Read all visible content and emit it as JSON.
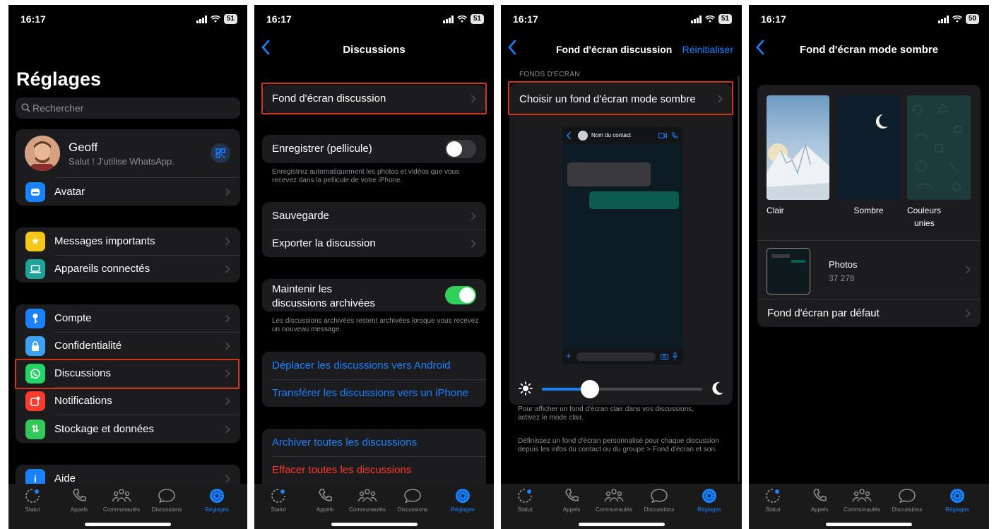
{
  "colors": {
    "accent": "#1a82ff",
    "destructive": "#ff3b30",
    "toggle_on": "#30d158",
    "highlight": "#d0351f"
  },
  "tabbar": {
    "items": [
      {
        "label": "Statut",
        "icon": "status-icon"
      },
      {
        "label": "Appels",
        "icon": "phone-icon"
      },
      {
        "label": "Communautés",
        "icon": "communities-icon"
      },
      {
        "label": "Discussions",
        "icon": "chat-bubble-icon"
      },
      {
        "label": "Réglages",
        "icon": "settings-gear-icon",
        "active": true
      }
    ]
  },
  "screen1": {
    "time": "16:17",
    "battery": "51",
    "title": "Réglages",
    "search_placeholder": "Rechercher",
    "profile": {
      "name": "Geoff",
      "status": "Salut ! J'utilise WhatsApp."
    },
    "avatar_row": "Avatar",
    "group2": [
      "Messages importants",
      "Appareils connectés"
    ],
    "group3": [
      "Compte",
      "Confidentialité",
      "Discussions",
      "Notifications",
      "Stockage et données"
    ],
    "help": "Aide"
  },
  "screen2": {
    "time": "16:17",
    "battery": "51",
    "title": "Discussions",
    "wallpaper": "Fond d'écran discussion",
    "save_camera": "Enregistrer (pellicule)",
    "save_camera_note": "Enregistrez automatiquement les photos et vidéos que vous recevez dans la pellicule de votre iPhone.",
    "backup": "Sauvegarde",
    "export": "Exporter la discussion",
    "keep_archived_line1": "Maintenir les",
    "keep_archived_line2": "discussions archivées",
    "keep_archived_note": "Les discussions archivées restent archivées lorsque vous recevez un nouveau message.",
    "move_android": "Déplacer les discussions vers Android",
    "transfer_iphone": "Transférer les discussions vers un iPhone",
    "archive_all": "Archiver toutes les discussions",
    "clear_all": "Effacer toutes les discussions"
  },
  "screen3": {
    "time": "16:17",
    "battery": "51",
    "title": "Fond d'écran discussion",
    "reset": "Réinitialiser",
    "section": "FONDS D'ÉCRAN",
    "choose_dark": "Choisir un fond d'écran mode sombre",
    "preview_contact": "Nom du contact",
    "brightness": 0.3,
    "note1": "Pour afficher un fond d'écran clair dans vos discussions, activez le mode clair.",
    "note2": "Définissez un fond d'écran personnalisé pour chaque discussion depuis les infos du contact ou du groupe > Fond d'écran et son."
  },
  "screen4": {
    "time": "16:17",
    "battery": "50",
    "title": "Fond d'écran mode sombre",
    "tiles": [
      {
        "line1": "Clair",
        "line2": ""
      },
      {
        "line1": "Sombre",
        "line2": ""
      },
      {
        "line1": "Couleurs",
        "line2": "unies"
      }
    ],
    "photos_label": "Photos",
    "photos_count": "37 278",
    "default_wallpaper": "Fond d'écran par défaut"
  }
}
